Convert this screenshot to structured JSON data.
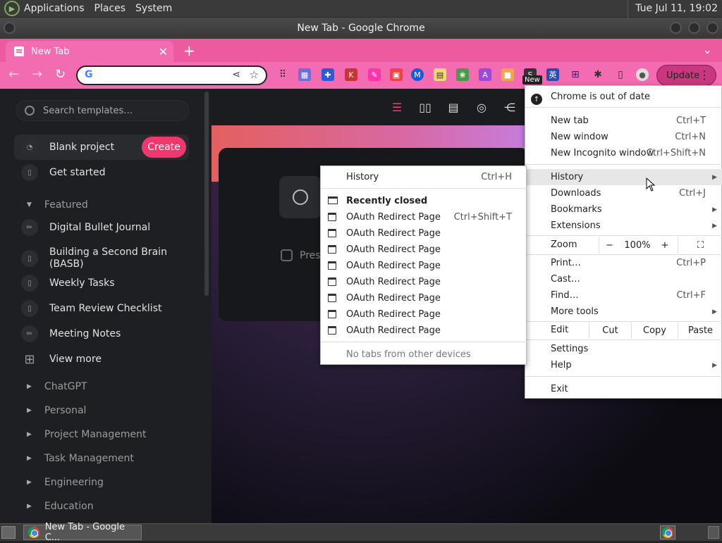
{
  "os": {
    "menus": [
      "Applications",
      "Places",
      "System"
    ],
    "clock": "Tue Jul 11, 19:02"
  },
  "window": {
    "title": "New Tab - Google Chrome"
  },
  "tabs": [
    {
      "label": "New Tab"
    }
  ],
  "toolbar": {
    "update_label": "Update",
    "new_badge": "New",
    "omnibox_value": ""
  },
  "sidebar": {
    "search_placeholder": "Search templates…",
    "blank_project": "Blank project",
    "create_label": "Create",
    "get_started": "Get started",
    "featured_label": "Featured",
    "featured_items": [
      "Digital Bullet Journal",
      "Building a Second Brain (BASB)",
      "Weekly Tasks",
      "Team Review Checklist",
      "Meeting Notes"
    ],
    "view_more": "View more",
    "groups": [
      "ChatGPT",
      "Personal",
      "Project Management",
      "Task Management",
      "Engineering",
      "Education"
    ]
  },
  "main": {
    "card_checkbox_label": "Pres"
  },
  "chrome_menu": {
    "out_of_date": "Chrome is out of date",
    "new_tab": "New tab",
    "new_tab_sc": "Ctrl+T",
    "new_window": "New window",
    "new_window_sc": "Ctrl+N",
    "new_incognito": "New Incognito window",
    "new_incognito_sc": "Ctrl+Shift+N",
    "history": "History",
    "downloads": "Downloads",
    "downloads_sc": "Ctrl+J",
    "bookmarks": "Bookmarks",
    "extensions": "Extensions",
    "zoom": "Zoom",
    "zoom_minus": "−",
    "zoom_value": "100%",
    "zoom_plus": "+",
    "print": "Print…",
    "print_sc": "Ctrl+P",
    "cast": "Cast…",
    "find": "Find…",
    "find_sc": "Ctrl+F",
    "more_tools": "More tools",
    "edit": "Edit",
    "cut": "Cut",
    "copy": "Copy",
    "paste": "Paste",
    "settings": "Settings",
    "help": "Help",
    "exit": "Exit"
  },
  "history_menu": {
    "history": "History",
    "history_sc": "Ctrl+H",
    "recently_closed": "Recently closed",
    "items": [
      {
        "label": "OAuth Redirect Page",
        "shortcut": "Ctrl+Shift+T"
      },
      {
        "label": "OAuth Redirect Page",
        "shortcut": ""
      },
      {
        "label": "OAuth Redirect Page",
        "shortcut": ""
      },
      {
        "label": "OAuth Redirect Page",
        "shortcut": ""
      },
      {
        "label": "OAuth Redirect Page",
        "shortcut": ""
      },
      {
        "label": "OAuth Redirect Page",
        "shortcut": ""
      },
      {
        "label": "OAuth Redirect Page",
        "shortcut": ""
      },
      {
        "label": "OAuth Redirect Page",
        "shortcut": ""
      }
    ],
    "no_tabs": "No tabs from other devices"
  },
  "taskbar": {
    "task_label": "New Tab - Google C..."
  },
  "colors": {
    "accent": "#f36bb0",
    "create": "#f0386f"
  }
}
